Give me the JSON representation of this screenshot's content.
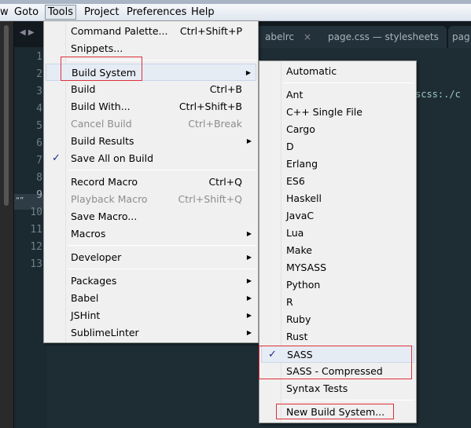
{
  "menubar": {
    "items": [
      "w",
      "Goto",
      "Tools",
      "Project",
      "Preferences",
      "Help"
    ],
    "active": "Tools"
  },
  "tabs": [
    {
      "label": "abelrc",
      "close": "×"
    },
    {
      "label": "page.css — stylesheets",
      "close": "×"
    },
    {
      "label": "pag",
      "close": ""
    }
  ],
  "gutter": {
    "lines": [
      "1",
      "2",
      "3",
      "4",
      "5",
      "6",
      "7",
      "8",
      "9",
      "10",
      "11",
      "12",
      "13"
    ],
    "current_line": "9",
    "bookmark": "“”"
  },
  "code_fragment": "scss:./c",
  "tools_menu": {
    "items": [
      {
        "label": "Command Palette...",
        "shortcut": "Ctrl+Shift+P"
      },
      {
        "label": "Snippets..."
      },
      {
        "sep": true
      },
      {
        "label": "Build System",
        "submenu": true,
        "highlighted": true
      },
      {
        "label": "Build",
        "shortcut": "Ctrl+B"
      },
      {
        "label": "Build With...",
        "shortcut": "Ctrl+Shift+B"
      },
      {
        "label": "Cancel Build",
        "shortcut": "Ctrl+Break",
        "disabled": true
      },
      {
        "label": "Build Results",
        "submenu": true
      },
      {
        "label": "Save All on Build",
        "checked": true
      },
      {
        "sep": true
      },
      {
        "label": "Record Macro",
        "shortcut": "Ctrl+Q"
      },
      {
        "label": "Playback Macro",
        "shortcut": "Ctrl+Shift+Q",
        "disabled": true
      },
      {
        "label": "Save Macro..."
      },
      {
        "label": "Macros",
        "submenu": true
      },
      {
        "sep": true
      },
      {
        "label": "Developer",
        "submenu": true
      },
      {
        "sep": true
      },
      {
        "label": "Packages",
        "submenu": true
      },
      {
        "label": "Babel",
        "submenu": true
      },
      {
        "label": "JSHint",
        "submenu": true
      },
      {
        "label": "SublimeLinter",
        "submenu": true
      }
    ]
  },
  "build_system_menu": {
    "items": [
      {
        "label": "Automatic"
      },
      {
        "sep": true
      },
      {
        "label": "Ant"
      },
      {
        "label": "C++ Single File"
      },
      {
        "label": "Cargo"
      },
      {
        "label": "D"
      },
      {
        "label": "Erlang"
      },
      {
        "label": "ES6"
      },
      {
        "label": "Haskell"
      },
      {
        "label": "JavaC"
      },
      {
        "label": "Lua"
      },
      {
        "label": "Make"
      },
      {
        "label": "MYSASS"
      },
      {
        "label": "Python"
      },
      {
        "label": "R"
      },
      {
        "label": "Ruby"
      },
      {
        "label": "Rust"
      },
      {
        "label": "SASS",
        "checked": true,
        "highlighted": true
      },
      {
        "label": "SASS - Compressed"
      },
      {
        "label": "Syntax Tests"
      },
      {
        "sep": true
      },
      {
        "label": "New Build System..."
      }
    ]
  },
  "colors": {
    "annotation_box": "#e0303a",
    "editor_bg": "#1e2c34",
    "check": "#1a2a8a"
  },
  "icons": {
    "check": "✓",
    "submenu_arrow": "▶",
    "nav": "◀ ▶"
  }
}
